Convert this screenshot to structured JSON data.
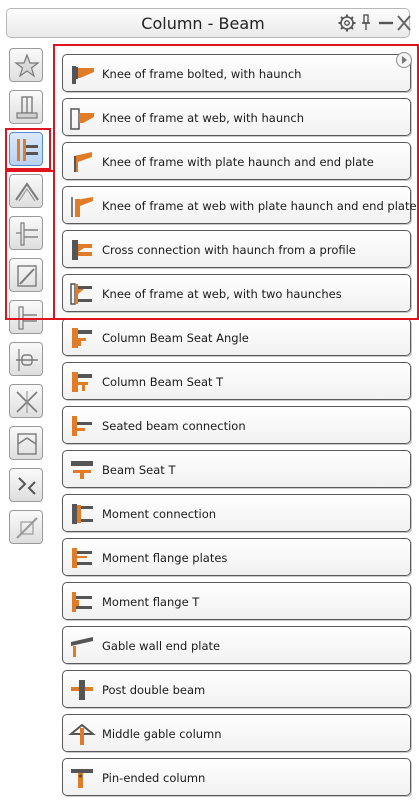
{
  "window": {
    "title": "Column - Beam"
  },
  "sidebar": {
    "categories": [
      {
        "icon": "favorites-star-icon",
        "active": false
      },
      {
        "icon": "column-base-icon",
        "active": false
      },
      {
        "icon": "column-beam-icon",
        "active": true
      },
      {
        "icon": "apex-icon",
        "active": false
      },
      {
        "icon": "beam-splice-icon",
        "active": false
      },
      {
        "icon": "bracing-icon",
        "active": false
      },
      {
        "icon": "beam-beam-icon",
        "active": false
      },
      {
        "icon": "tube-connection-icon",
        "active": false
      },
      {
        "icon": "cross-bracing-icon",
        "active": false
      },
      {
        "icon": "frame-connection-icon",
        "active": false
      },
      {
        "icon": "transform-arrows-icon",
        "active": false
      },
      {
        "icon": "disabled-tools-icon",
        "active": false
      }
    ]
  },
  "items": [
    {
      "label": "Knee of frame bolted, with haunch",
      "icon": "knee-haunch-bolted-icon"
    },
    {
      "label": "Knee of frame at web, with haunch",
      "icon": "knee-web-haunch-icon"
    },
    {
      "label": "Knee of frame with plate haunch and end plate",
      "icon": "knee-plate-haunch-icon"
    },
    {
      "label": "Knee of frame at web with plate haunch and end plate",
      "icon": "knee-web-plate-haunch-icon"
    },
    {
      "label": "Cross connection with haunch from a profile",
      "icon": "cross-connection-haunch-icon"
    },
    {
      "label": "Knee of frame at web, with two haunches",
      "icon": "knee-two-haunches-icon"
    },
    {
      "label": "Column Beam Seat Angle",
      "icon": "seat-angle-icon"
    },
    {
      "label": "Column Beam Seat T",
      "icon": "seat-t-icon"
    },
    {
      "label": "Seated beam connection",
      "icon": "seated-beam-icon"
    },
    {
      "label": "Beam Seat T",
      "icon": "beam-seat-t-icon"
    },
    {
      "label": "Moment connection",
      "icon": "moment-connection-icon"
    },
    {
      "label": "Moment flange plates",
      "icon": "moment-flange-plates-icon"
    },
    {
      "label": "Moment flange T",
      "icon": "moment-flange-t-icon"
    },
    {
      "label": "Gable wall end plate",
      "icon": "gable-wall-end-plate-icon"
    },
    {
      "label": "Post double beam",
      "icon": "post-double-beam-icon"
    },
    {
      "label": "Middle gable column",
      "icon": "middle-gable-column-icon"
    },
    {
      "label": "Pin-ended column",
      "icon": "pin-ended-column-icon"
    }
  ],
  "colors": {
    "highlight": "#e0141e",
    "steel_orange": "#e07b28",
    "steel_gray": "#6b6b6b",
    "active_blue": "#b8d2f2"
  }
}
